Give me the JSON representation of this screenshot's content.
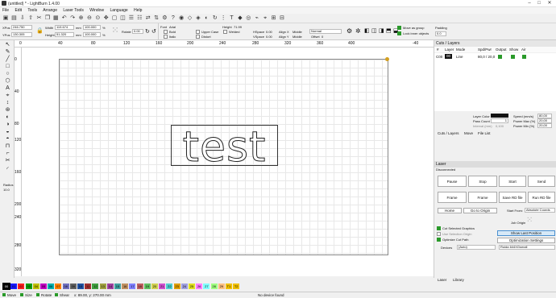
{
  "window": {
    "title": "(untitled) * - LightBurn 1.4.00",
    "min": "–",
    "max": "□",
    "close": "✕"
  },
  "menu": [
    "File",
    "Edit",
    "Tools",
    "Arrange",
    "Laser Tools",
    "Window",
    "Language",
    "Help"
  ],
  "numedit": {
    "xpos_label": "XPos",
    "xpos": "246.750",
    "ypos_label": "YPos",
    "ypos": "130.305",
    "width_label": "Width",
    "width": "119.674",
    "height_label": "Height",
    "height": "51.320",
    "unit": "mm",
    "wpct": "100.000",
    "hpct": "100.000",
    "pct": "%",
    "rotate_label": "Rotate",
    "rotate": "0.00"
  },
  "font": {
    "font_label": "Font",
    "font": "Arial",
    "height_label": "Height",
    "height": "71.99",
    "hspace_label": "HSpace",
    "hspace": "0.00",
    "vspace_label": "VSpace",
    "vspace": "0.00",
    "alignx_label": "Align X",
    "alignx": "Middle",
    "aligny_label": "Align Y",
    "aligny": "Middle",
    "style": "Normal",
    "offset_label": "Offset",
    "offset": "0",
    "bold": "Bold",
    "italic": "Italic",
    "upper": "Upper Case",
    "distort": "Distort",
    "welded": "Welded"
  },
  "group": {
    "move_as_group": "Move as group",
    "lock_inner": "Lock inner objects"
  },
  "padding": {
    "label": "Padding",
    "value": "0.0"
  },
  "ruler_top": [
    "0",
    "40",
    "80",
    "120",
    "160",
    "200",
    "240",
    "280",
    "320",
    "360",
    "400",
    "-40"
  ],
  "ruler_left": [
    "0",
    "40",
    "80",
    "120",
    "160",
    "200",
    "240",
    "280",
    "320"
  ],
  "canvas": {
    "text": "test"
  },
  "left_radius": {
    "label": "Radius",
    "value": "10.0"
  },
  "cuts": {
    "title": "Cuts / Layers",
    "headers": [
      "#",
      "Layer",
      "Mode",
      "Spd/Pwr",
      "Output",
      "Show",
      "Air"
    ],
    "row": {
      "num": "C00",
      "layer": "00",
      "mode": "Line",
      "spdpwr": "80,0 / 20,0"
    },
    "layer_color_label": "Layer Color",
    "speed_label": "Speed (mm/s)",
    "speed": "80,00",
    "pass_label": "Pass Count",
    "pass": "1",
    "powmax_label": "Power Max (%)",
    "powmax": "20,00",
    "interval_label": "Interval (mm)",
    "interval": "0,100",
    "powmin_label": "Power Min (%)",
    "powmin": "20,00"
  },
  "panel_tabs": [
    "Cuts / Layers",
    "Move",
    "File List"
  ],
  "laser": {
    "title": "Laser",
    "status": "Disconnected",
    "pause": "Pause",
    "stop": "Stop",
    "start": "Start",
    "send": "Send",
    "frame1": "Frame",
    "frame2": "Frame",
    "save": "Save RD file",
    "run": "Run RD file",
    "home": "Home",
    "goto": "Go to Origin",
    "start_from_label": "Start From:",
    "start_from": "Absolute Coords",
    "job_origin": "Job Origin",
    "cut_selected": "Cut Selected Graphics",
    "use_selection": "Use Selection Origin",
    "show_last": "Show Last Position",
    "optimize": "Optimize Cut Path",
    "opt_settings": "Optimization Settings",
    "devices_label": "Devices",
    "devices": "(Auto)",
    "controller": "Ruida 644XGsmall"
  },
  "bottom_tabs": [
    "Laser",
    "Library"
  ],
  "palette": [
    "00",
    "01",
    "02",
    "03",
    "04",
    "05",
    "06",
    "07",
    "08",
    "09",
    "10",
    "11",
    "12",
    "13",
    "14",
    "15",
    "16",
    "17",
    "18",
    "19",
    "20",
    "21",
    "22",
    "23",
    "24",
    "25",
    "26",
    "27",
    "28",
    "29",
    "T1",
    "T2"
  ],
  "palette_colors": [
    "#000000",
    "#1a1aff",
    "#ff2020",
    "#10a010",
    "#c0c000",
    "#c000c0",
    "#00b0b0",
    "#ff8000",
    "#7070c0",
    "#606060",
    "#2050a0",
    "#a03030",
    "#40a040",
    "#a0a040",
    "#a040a0",
    "#40a0a0",
    "#c09060",
    "#8080ff",
    "#c06060",
    "#60c060",
    "#d0d050",
    "#d050d0",
    "#50d0d0",
    "#e0a000",
    "#a0a0e0",
    "#e0e020",
    "#ff80ff",
    "#80ffff",
    "#a0ff80",
    "#ffc080",
    "#f0c000",
    "#f0c000"
  ],
  "status": {
    "move": "Move",
    "size": "Size",
    "rotate": "Rotate",
    "shear": "Shear",
    "coords": "x: 89.00, y: 270.00 mm",
    "device": "No device found"
  }
}
